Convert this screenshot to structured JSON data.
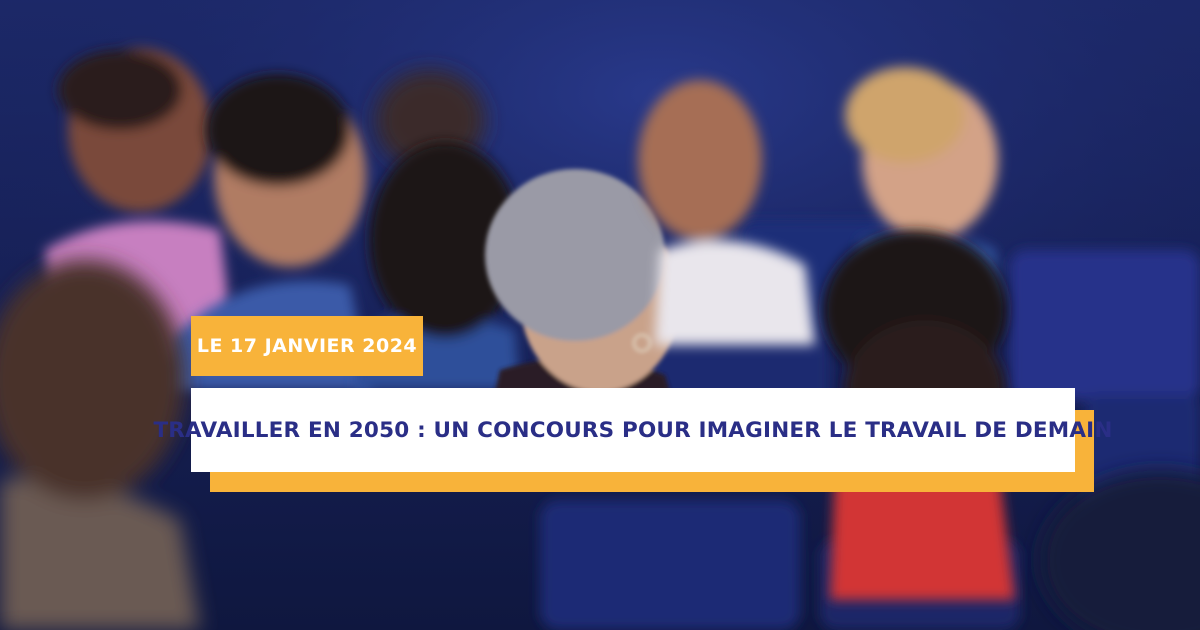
{
  "banner": {
    "date": "LE 17 JANVIER 2024",
    "title": "TRAVAILLER EN 2050 : UN CONCOURS POUR IMAGINER LE TRAVAIL DE DEMAIN"
  },
  "colors": {
    "accent": "#f8b33a",
    "title_text": "#2a2e86",
    "background": "#1a2461"
  }
}
